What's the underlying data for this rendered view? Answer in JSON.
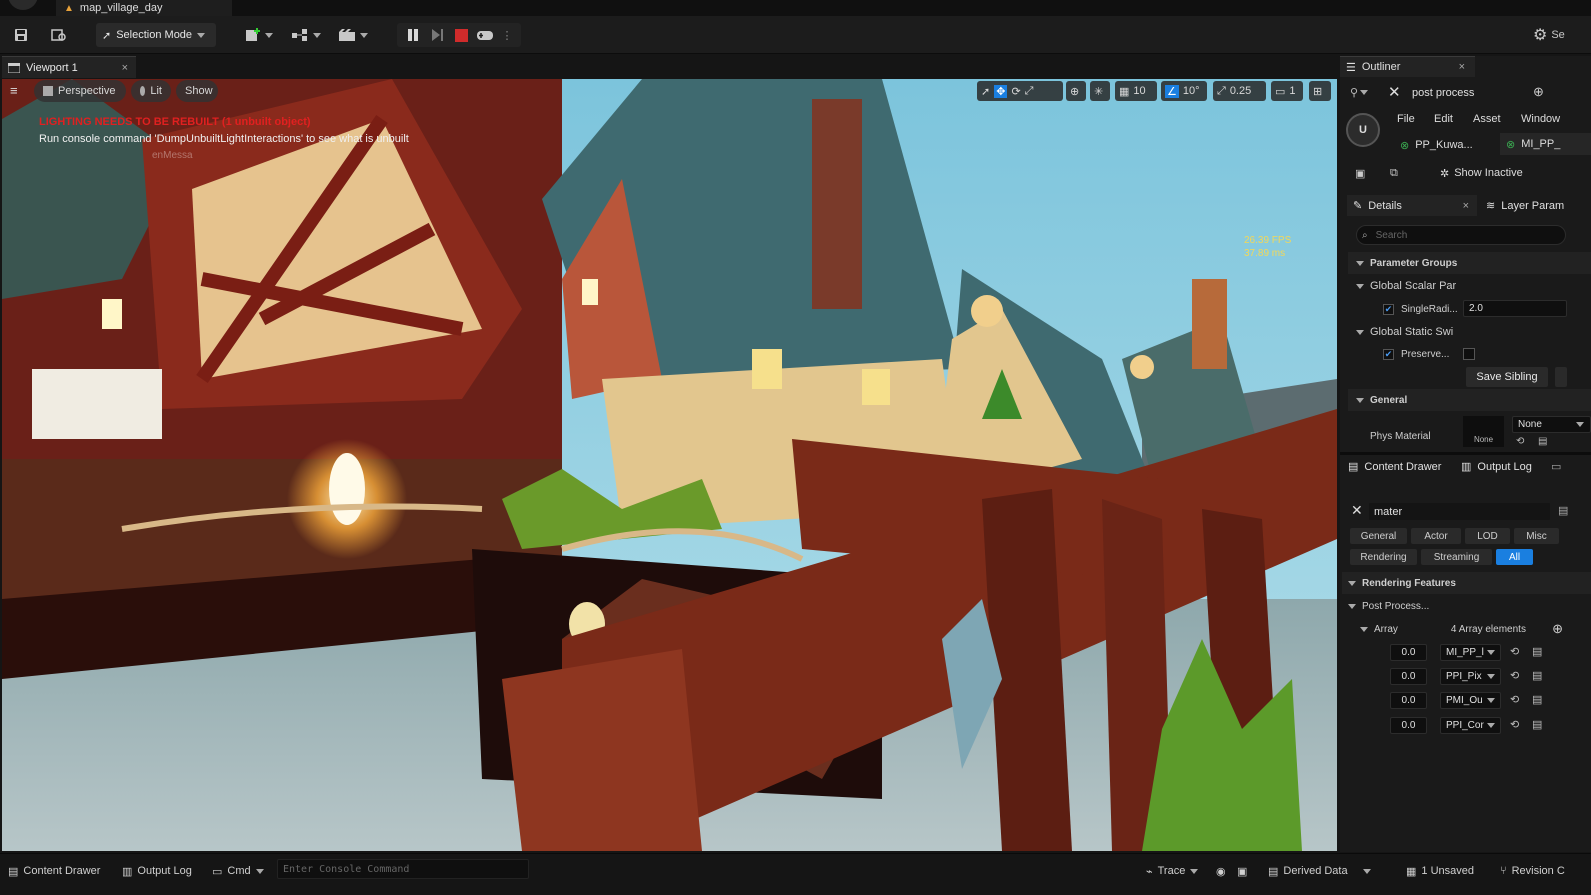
{
  "window": {
    "title": "map_village_day",
    "right_label": "Se"
  },
  "toolbar": {
    "selection_mode": "Selection Mode"
  },
  "viewport": {
    "tab_label": "Viewport 1",
    "perspective": "Perspective",
    "lit": "Lit",
    "show": "Show",
    "grid_snap": "10",
    "angle_snap": "10°",
    "scale_snap": "0.25",
    "camera_speed": "1",
    "warning": "LIGHTING NEEDS TO BE REBUILT (1 unbuilt object)",
    "hint": "Run console command 'DumpUnbuiltLightInteractions' to see what is unbuilt",
    "faded_text": "enMessa",
    "fps": "26.39 FPS",
    "ms": "37.89 ms"
  },
  "outliner": {
    "tab_label": "Outliner",
    "search_value": "post process"
  },
  "material_editor": {
    "menus": [
      "File",
      "Edit",
      "Asset",
      "Window"
    ],
    "tabs": [
      "PP_Kuwa...",
      "MI_PP_"
    ],
    "show_inactive": "Show Inactive",
    "details_tab": "Details",
    "layer_params_tab": "Layer Param",
    "search_placeholder": "Search",
    "parameter_groups": "Parameter Groups",
    "global_scalar": "Global Scalar Par",
    "scalar_param": "SingleRadi...",
    "scalar_value": "2.0",
    "global_static": "Global Static Swi",
    "static_param": "Preserve...",
    "save_sibling": "Save Sibling",
    "general": "General",
    "phys_material": "Phys Material",
    "phys_thumb": "None",
    "phys_dropdown": "None"
  },
  "bottom_tabs": {
    "content_drawer": "Content Drawer",
    "output_log": "Output Log"
  },
  "filter": {
    "search_value": "mater",
    "buttons": [
      "General",
      "Actor",
      "LOD",
      "Misc",
      "Rendering",
      "Streaming",
      "All"
    ],
    "rendering_features": "Rendering Features",
    "post_process": "Post Process...",
    "array_label": "Array",
    "array_count": "4 Array elements",
    "elements": [
      {
        "weight": "0.0",
        "asset": "MI_PP_l"
      },
      {
        "weight": "0.0",
        "asset": "PPI_Pix"
      },
      {
        "weight": "0.0",
        "asset": "PMI_Ou"
      },
      {
        "weight": "0.0",
        "asset": "PPI_Cor"
      }
    ]
  },
  "statusbar": {
    "content_drawer": "Content Drawer",
    "output_log": "Output Log",
    "cmd": "Cmd",
    "console_placeholder": "Enter Console Command",
    "trace": "Trace",
    "derived_data": "Derived Data",
    "unsaved": "1 Unsaved",
    "revision": "Revision C"
  },
  "colors": {
    "accent": "#1a7fe0",
    "warning": "#e02020",
    "fps": "#f2d85a",
    "stop": "#d02b2b"
  }
}
